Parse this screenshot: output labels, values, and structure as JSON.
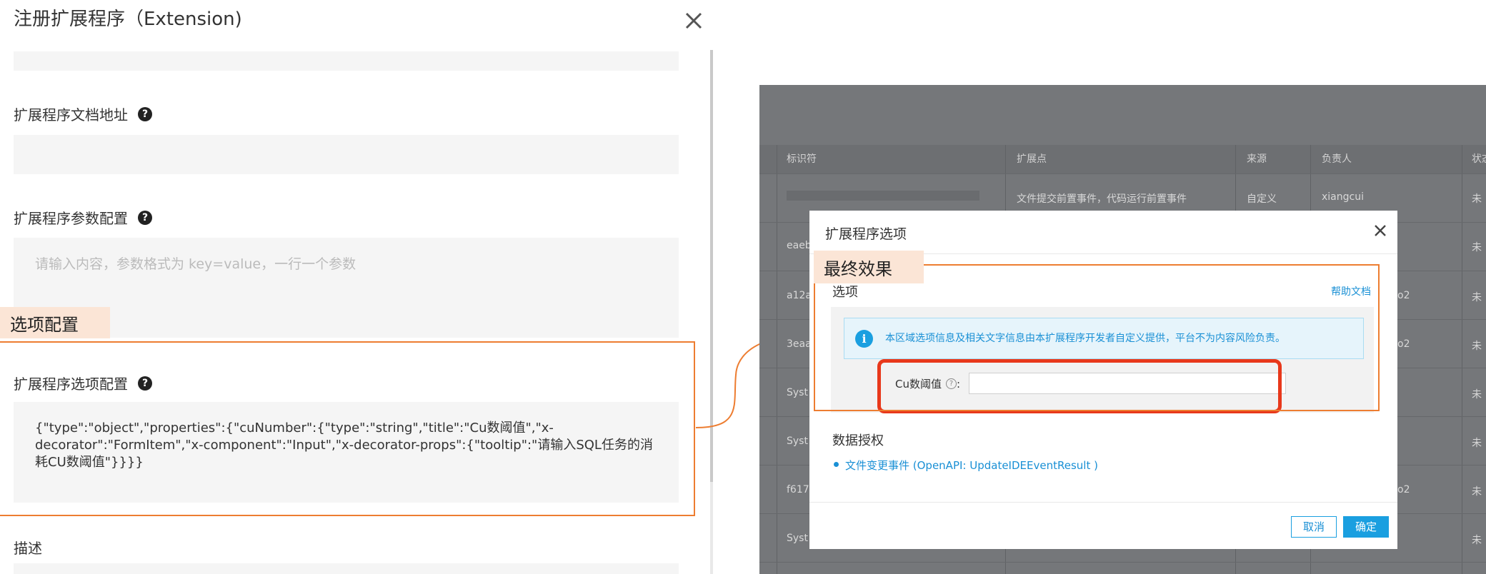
{
  "left_panel": {
    "title": "注册扩展程序（Extension)",
    "fields": [
      {
        "label": "扩展程序文档地址",
        "value": ""
      },
      {
        "label": "扩展程序参数配置",
        "placeholder": "请输入内容，参数格式为 key=value，一行一个参数"
      },
      {
        "label": "扩展程序选项配置",
        "value": "{\"type\":\"object\",\"properties\":{\"cuNumber\":{\"type\":\"string\",\"title\":\"Cu数阈值\",\"x-decorator\":\"FormItem\",\"x-component\":\"Input\",\"x-decorator-props\":{\"tooltip\":\"请输入SQL任务的消耗CU数阈值\"}}}}"
      },
      {
        "label": "描述",
        "value": ""
      }
    ],
    "callout": "选项配置",
    "help_icon": "question-circle-icon",
    "close_icon": "close-icon"
  },
  "right_screenshot": {
    "table": {
      "headers": [
        "标识符",
        "扩展点",
        "来源",
        "负责人",
        "状态"
      ],
      "rows": [
        {
          "id": "",
          "point": "文件提交前置事件，代码运行前置事件",
          "source": "自定义",
          "owner": "xiangcui",
          "status": "未"
        },
        {
          "id": "eaeb",
          "point": "",
          "source": "",
          "owner": "",
          "status": "未"
        },
        {
          "id": "a12a",
          "point": "",
          "source": "",
          "owner": "o2",
          "status": "未"
        },
        {
          "id": "3eaa",
          "point": "",
          "source": "",
          "owner": "o2",
          "status": "未"
        },
        {
          "id": "Syst",
          "point": "",
          "source": "",
          "owner": "",
          "status": "未"
        },
        {
          "id": "Syst",
          "point": "",
          "source": "",
          "owner": "",
          "status": "未"
        },
        {
          "id": "f617",
          "point": "",
          "source": "",
          "owner": "o2",
          "status": "未"
        },
        {
          "id": "Syst",
          "point": "",
          "source": "",
          "owner": "",
          "status": "未"
        }
      ]
    },
    "dialog": {
      "title": "扩展程序选项",
      "callout": "最终效果",
      "options_title": "选项",
      "help_link": "帮助文档",
      "info_text": "本区域选项信息及相关文字信息由本扩展程序开发者自定义提供，平台不为内容风险负责。",
      "cu_label": "Cu数阈值",
      "cu_value": "",
      "data_auth_title": "数据授权",
      "data_auth_item": "文件变更事件 (OpenAPI: UpdateIDEEventResult )",
      "cancel_label": "取消",
      "ok_label": "确定"
    }
  },
  "colors": {
    "accent_orange": "#ed7d31",
    "callout_bg": "#fbe5d6",
    "highlight_red": "#e8381b",
    "primary_blue": "#1a9fe0",
    "overlay_gray": "#75777a"
  }
}
